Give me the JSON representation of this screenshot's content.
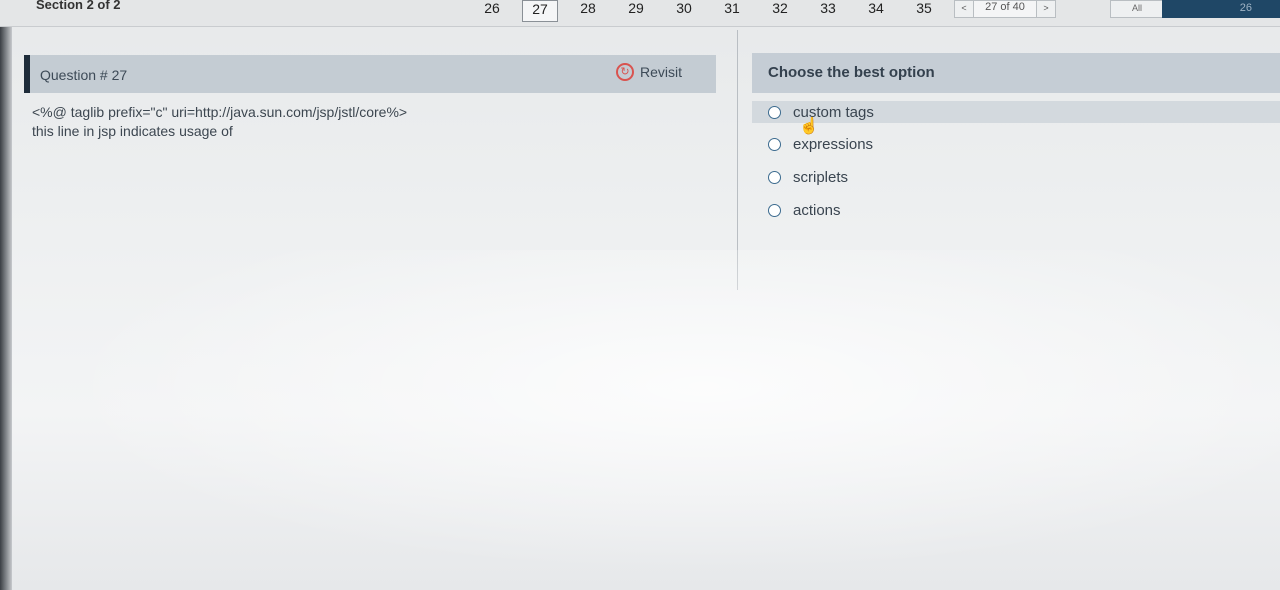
{
  "topbar": {
    "section": "Section 2 of 2",
    "question_numbers": [
      "26",
      "27",
      "28",
      "29",
      "30",
      "31",
      "32",
      "33",
      "34",
      "35"
    ],
    "active_question": "27",
    "pager": {
      "prev": "<",
      "status": "27 of 40",
      "next": ">"
    },
    "filter": "All",
    "corner_value": "26"
  },
  "question": {
    "title": "Question # 27",
    "revisit_label": "Revisit",
    "text_line1": "<%@ taglib prefix=\"c\" uri=http://java.sun.com/jsp/jstl/core%>",
    "text_line2": "this line in jsp indicates usage of"
  },
  "options": {
    "title": "Choose the best option",
    "items": [
      {
        "label": "custom tags"
      },
      {
        "label": "expressions"
      },
      {
        "label": "scriplets"
      },
      {
        "label": "actions"
      }
    ]
  },
  "icons": {
    "revisit": "revisit-icon",
    "cursor": "hand-pointer-icon"
  },
  "colors": {
    "header_bg": "#c4ccd3",
    "revisit_accent": "#d9534f",
    "corner_bg": "#1f4766"
  }
}
